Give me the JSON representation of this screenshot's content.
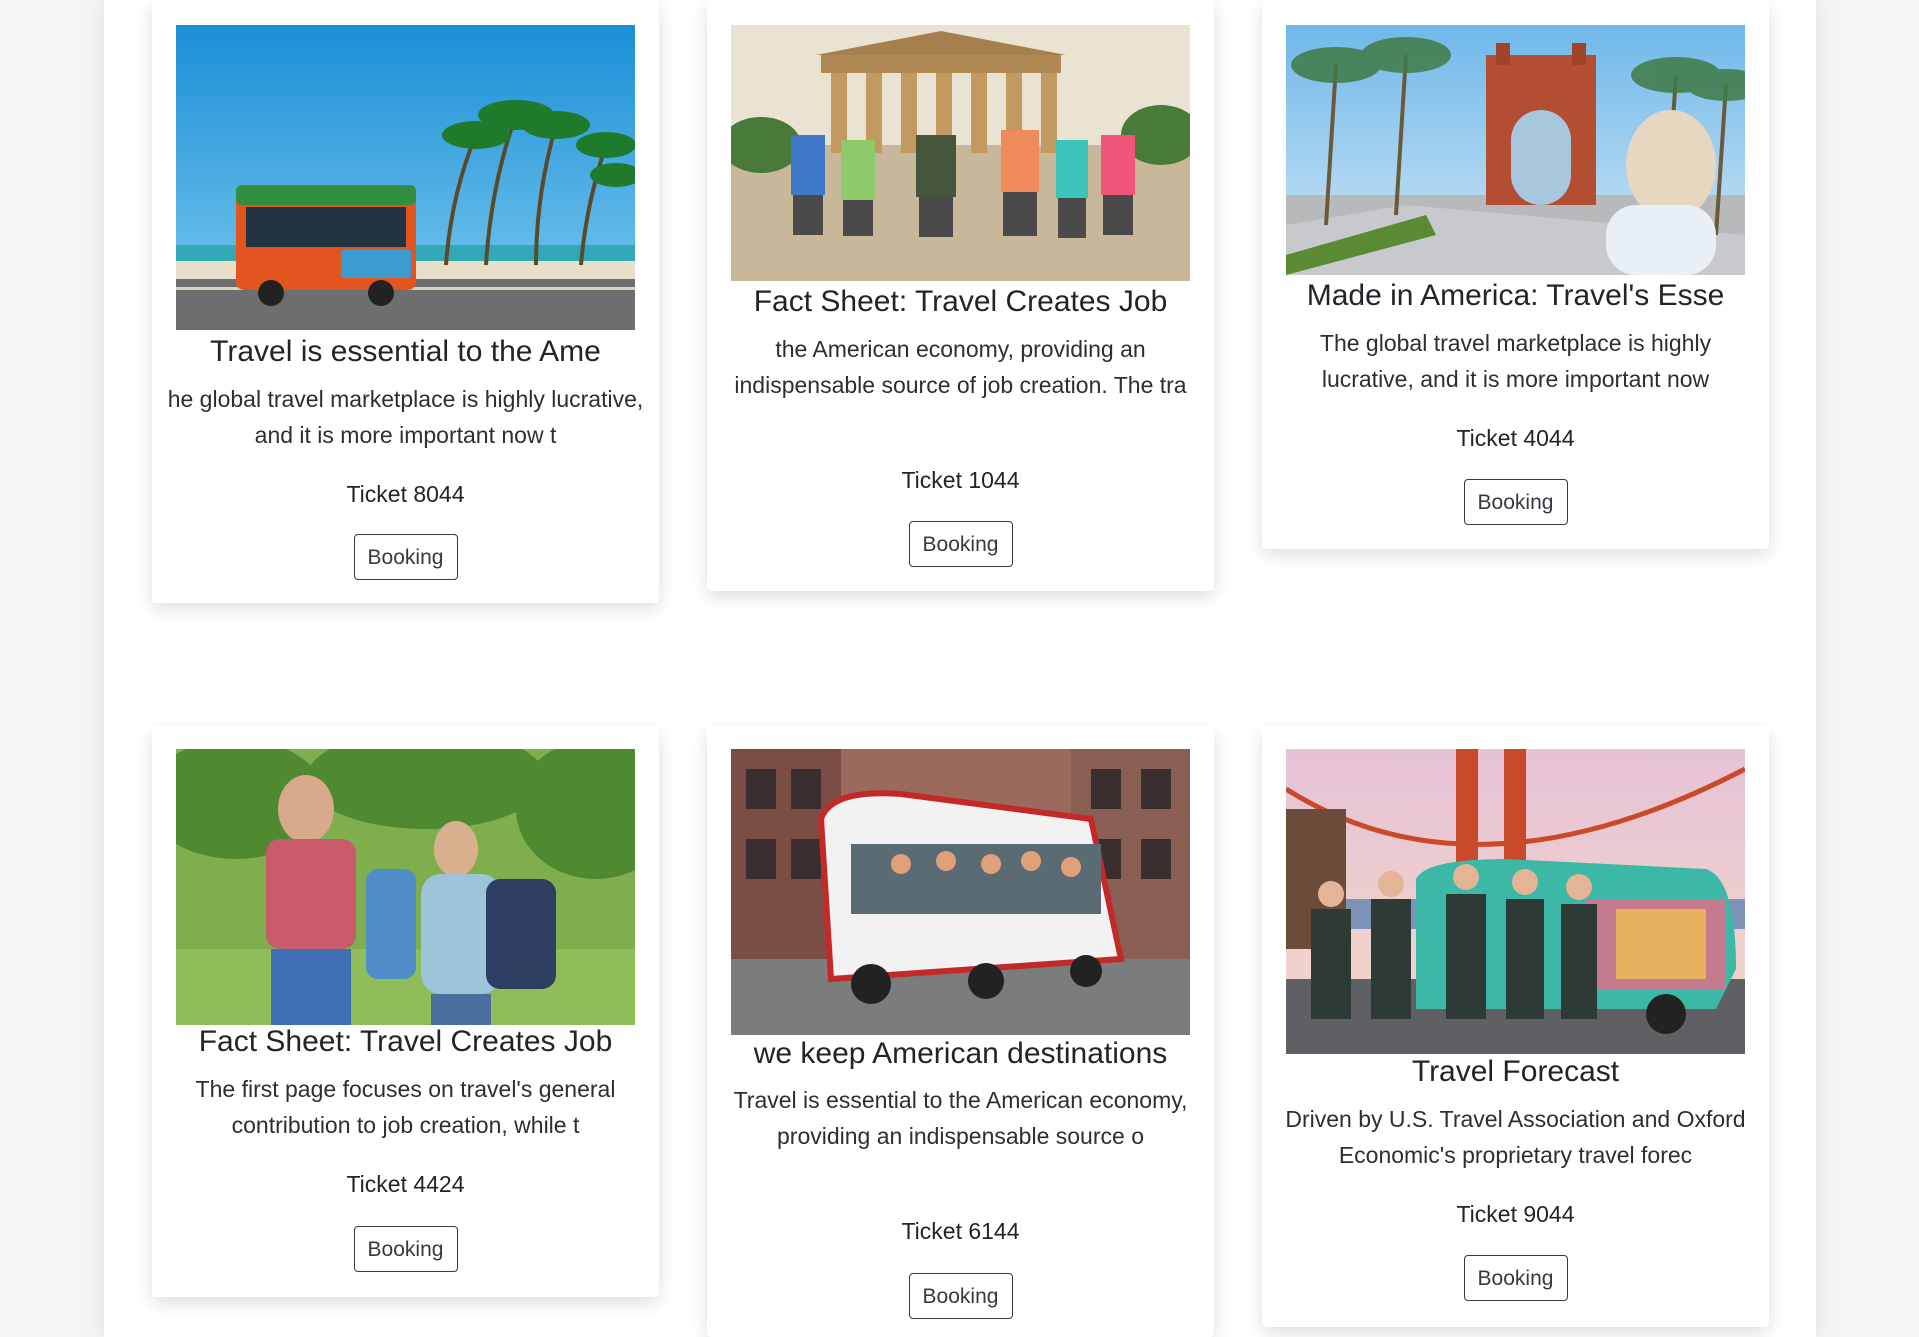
{
  "cards": [
    {
      "image_label": "trolley-beach-photo",
      "title": "Travel is essential to the Ame",
      "text": "he global travel marketplace is highly lucrative, and it is more important now t",
      "ticket": "Ticket 8044",
      "button": "Booking"
    },
    {
      "image_label": "group-temple-photo",
      "title": "Fact Sheet: Travel Creates Job",
      "text": "the American economy, providing an indispensable source of job creation. The tra",
      "ticket": "Ticket 1044",
      "button": "Booking"
    },
    {
      "image_label": "arc-de-triomf-photo",
      "title": "Made in America: Travel's Esse",
      "text": "The global travel marketplace is highly lucrative, and it is more important now",
      "ticket": "Ticket 4044",
      "button": "Booking"
    },
    {
      "image_label": "students-walking-photo",
      "title": "Fact Sheet: Travel Creates Job",
      "text": "The first page focuses on travel's general contribution to job creation, while t",
      "ticket": "Ticket 4424",
      "button": "Booking"
    },
    {
      "image_label": "open-tour-cart-photo",
      "title": "we keep American destinations",
      "text": "Travel is essential to the American economy, providing an indispensable source o",
      "ticket": "Ticket 6144",
      "button": "Booking"
    },
    {
      "image_label": "golden-gate-van-photo",
      "title": "Travel Forecast",
      "text": "Driven by U.S. Travel Association and Oxford Economic's proprietary travel forec",
      "ticket": "Ticket 9044",
      "button": "Booking"
    }
  ]
}
